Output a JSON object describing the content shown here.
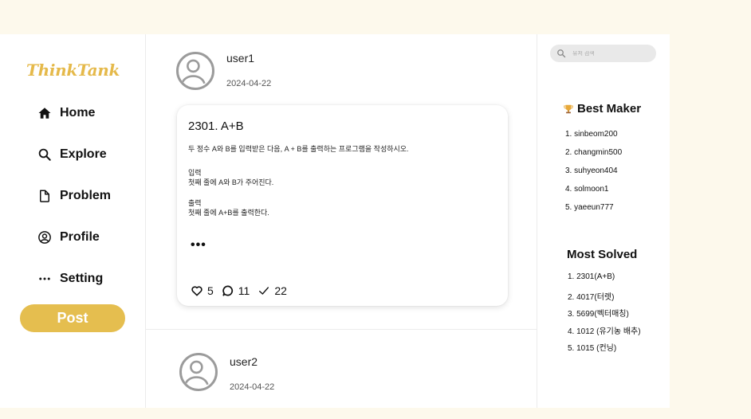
{
  "app": {
    "logo": "ThinkTank"
  },
  "nav": [
    {
      "label": "Home",
      "icon": "home-icon"
    },
    {
      "label": "Explore",
      "icon": "search-icon"
    },
    {
      "label": "Problem",
      "icon": "document-icon"
    },
    {
      "label": "Profile",
      "icon": "user-circle-icon"
    },
    {
      "label": "Setting",
      "icon": "more-dots-icon"
    }
  ],
  "post_button": "Post",
  "posts": [
    {
      "username": "user1",
      "date": "2024-04-22",
      "problem_title": "2301. A+B",
      "description": "두 정수 A와 B를 입력받은 다음, A + B를 출력하는 프로그램을 작성하시오.",
      "input_heading": "입력",
      "input_text": "첫째 줄에 A와 B가 주어진다.",
      "output_heading": "출력",
      "output_text": "첫째 줄에 A+B를 출력한다.",
      "ellipsis": "•••",
      "likes": "5",
      "comments": "11",
      "solved": "22"
    },
    {
      "username": "user2",
      "date": "2024-04-22"
    }
  ],
  "search": {
    "placeholder": "유저 검색",
    "icon": "search-icon"
  },
  "best_maker": {
    "title": "Best Maker",
    "icon": "trophy-icon",
    "items": [
      "1. sinbeom200",
      "2. changmin500",
      "3. suhyeon404",
      "4. solmoon1",
      "5. yaeeun777"
    ]
  },
  "most_solved": {
    "title": "Most Solved",
    "items": [
      "1. 2301(A+B)",
      "2. 4017(터렛)",
      "3. 5699(벡터매칭)",
      "4. 1012 (유기농 배추)",
      "5. 1015 (컨닝)"
    ]
  },
  "colors": {
    "accent": "#e5be4f",
    "background": "#fdf9ec"
  }
}
